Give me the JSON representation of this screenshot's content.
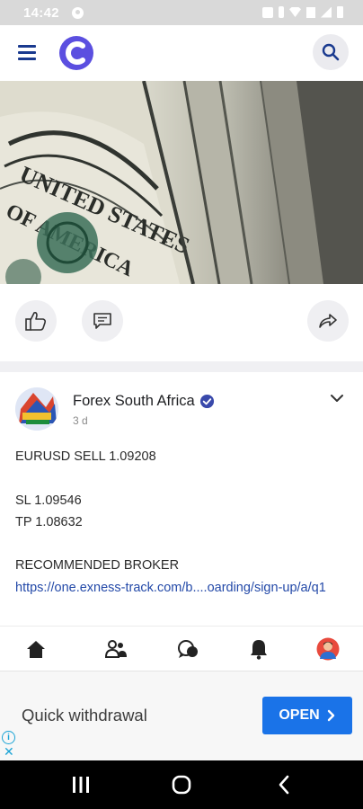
{
  "status_bar": {
    "time": "14:42"
  },
  "post": {
    "author": "Forex South Africa",
    "time_ago": "3 d",
    "lines": {
      "signal": "EURUSD SELL 1.09208",
      "sl": "SL 1.09546",
      "tp": "TP 1.08632",
      "broker_heading": "RECOMMENDED BROKER",
      "link": "https://one.exness-track.com/b....oarding/sign-up/a/q1"
    }
  },
  "ad": {
    "text": "Quick withdrawal",
    "button_label": "OPEN"
  },
  "colors": {
    "brand": "#5b4fe0",
    "link": "#2349a8",
    "ad_button": "#1a73e8",
    "verified": "#3949ab"
  }
}
